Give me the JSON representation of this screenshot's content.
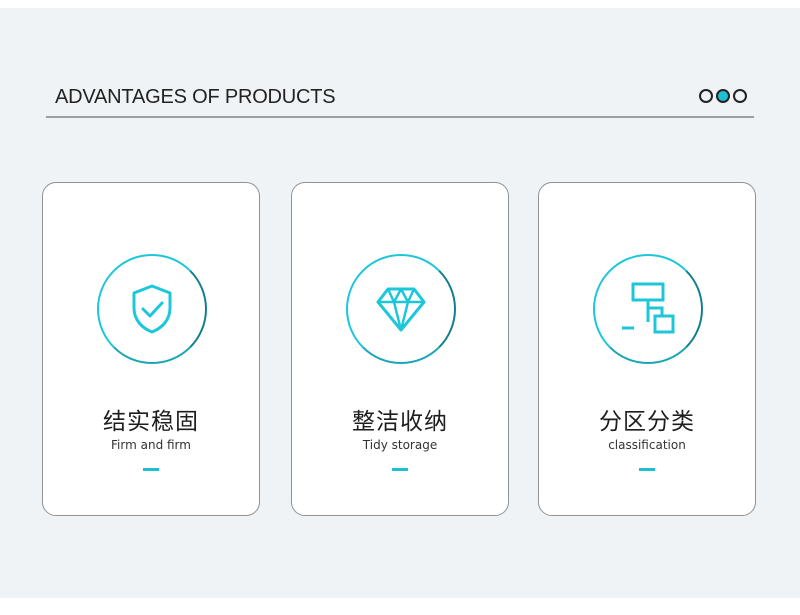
{
  "header": {
    "title": "ADVANTAGES OF PRODUCTS"
  },
  "colors": {
    "accent": "#1cbfd3",
    "panel_background": "#eff3f6"
  },
  "cards": [
    {
      "icon": "shield-check-icon",
      "title": "结实稳固",
      "subtitle": "Firm and firm"
    },
    {
      "icon": "diamond-icon",
      "title": "整洁收纳",
      "subtitle": "Tidy storage"
    },
    {
      "icon": "hierarchy-icon",
      "title": "分区分类",
      "subtitle": "classification"
    }
  ]
}
